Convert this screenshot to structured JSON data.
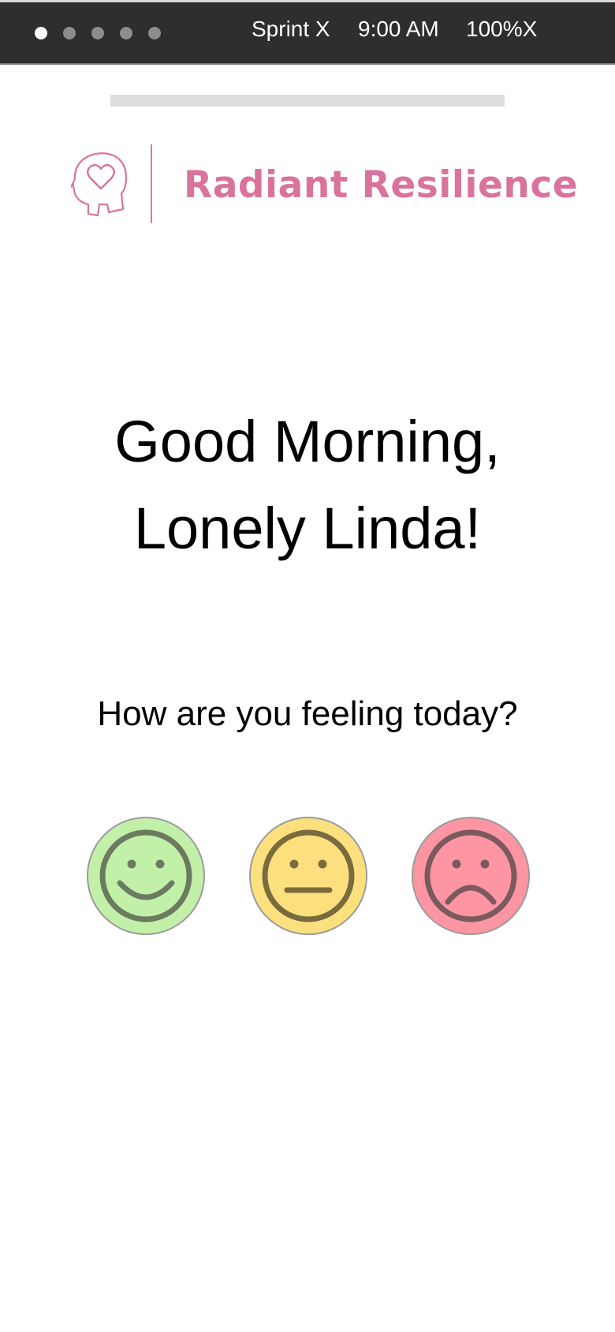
{
  "status_bar": {
    "carrier": "Sprint X",
    "time": "9:00 AM",
    "battery": "100%X",
    "signal_dots": 5,
    "signal_active": 1
  },
  "brand": {
    "name": "Radiant Resilience",
    "icon": "head-heart-icon",
    "color": "#d9739d"
  },
  "greeting": {
    "line1": "Good Morning,",
    "line2": "Lonely Linda!"
  },
  "prompt": "How are you feeling today?",
  "moods": [
    {
      "name": "happy",
      "icon": "happy-face-icon",
      "color": "#c3f0a9"
    },
    {
      "name": "neutral",
      "icon": "neutral-face-icon",
      "color": "#fce07e"
    },
    {
      "name": "sad",
      "icon": "sad-face-icon",
      "color": "#fe95a3"
    }
  ]
}
